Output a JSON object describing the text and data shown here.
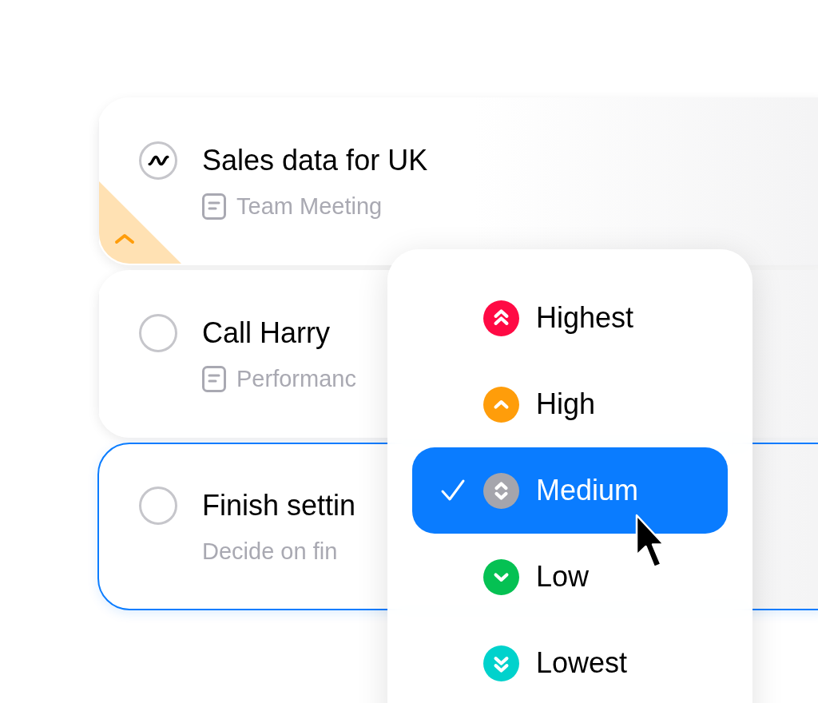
{
  "task_cards": [
    {
      "in_progress": true,
      "title": "Sales data for UK",
      "note": "Team Meeting",
      "high_priority": true,
      "selected": false
    },
    {
      "in_progress": false,
      "title": "Call Harry",
      "note": "Performanc",
      "high_priority": false,
      "selected": false
    },
    {
      "in_progress": false,
      "title": "Finish settin",
      "description": "Decide on fin",
      "high_priority": false,
      "selected": true
    }
  ],
  "priority_menu": {
    "options": [
      {
        "label": "Highest",
        "color": "#ff0a44",
        "selected": false
      },
      {
        "label": "High",
        "color": "#ff9d0a",
        "selected": false
      },
      {
        "label": "Medium",
        "color": "#a5a5ac",
        "selected": true
      },
      {
        "label": "Low",
        "color": "#05c153",
        "selected": false
      },
      {
        "label": "Lowest",
        "color": "#00d2cc",
        "selected": false
      }
    ]
  }
}
